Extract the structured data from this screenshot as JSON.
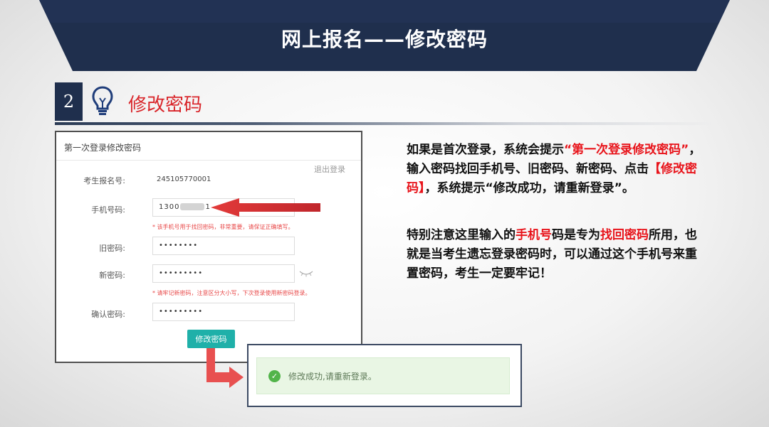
{
  "header": {
    "title": "网上报名——修改密码"
  },
  "section": {
    "number": "2",
    "title": "修改密码",
    "icon": "lightbulb-icon"
  },
  "form": {
    "heading": "第一次登录修改密码",
    "logout_link": "退出登录",
    "fields": {
      "exam_id": {
        "label": "考生报名号:",
        "value": "245105770001"
      },
      "phone": {
        "label": "手机号码:",
        "value_start": "1300",
        "value_end": "1",
        "hint": "* 该手机号用于找回密码，非常重要，请保证正确填写。"
      },
      "old_password": {
        "label": "旧密码:",
        "value": "••••••••"
      },
      "new_password": {
        "label": "新密码:",
        "value": "•••••••••",
        "hint": "* 请牢记新密码，注意区分大小写，下次登录使用新密码登录。"
      },
      "confirm_password": {
        "label": "确认密码:",
        "value": "•••••••••"
      }
    },
    "submit_label": "修改密码"
  },
  "success": {
    "message": "修改成功,请重新登录。"
  },
  "explanation": {
    "p1": [
      {
        "text": "如果是首次登录，系统会提示",
        "red": false
      },
      {
        "text": "“第一次登录修改密码”",
        "red": true
      },
      {
        "text": "，输入密码找回手机号、旧密码、新密码、点击",
        "red": false
      },
      {
        "text": "【修改密码】",
        "red": true
      },
      {
        "text": "，系统提示“修改成功，请重新登录”。",
        "red": false
      }
    ],
    "p2": [
      {
        "text": "特别注意这里输入的",
        "red": false
      },
      {
        "text": "手机号",
        "red": true
      },
      {
        "text": "码是专为",
        "red": false
      },
      {
        "text": "找回密码",
        "red": true
      },
      {
        "text": "所用，也就是当考生遗忘登录密码时，可以通过这个手机号来重置密码，考生一定要牢记！",
        "red": false
      }
    ]
  },
  "colors": {
    "banner": "#1f2f4d",
    "accent_red": "#e8141b",
    "button_teal": "#1fb0a9",
    "arrow_red": "#e85050"
  }
}
